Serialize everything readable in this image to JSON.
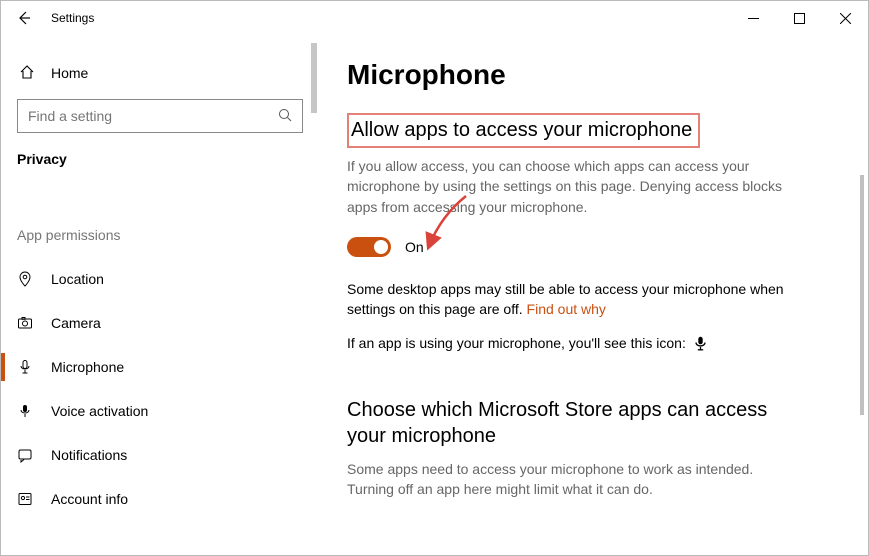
{
  "titlebar": {
    "app_title": "Settings"
  },
  "sidebar": {
    "home_label": "Home",
    "search_placeholder": "Find a setting",
    "current_page": "Privacy",
    "section_label": "App permissions",
    "items": [
      {
        "label": "Location"
      },
      {
        "label": "Camera"
      },
      {
        "label": "Microphone"
      },
      {
        "label": "Voice activation"
      },
      {
        "label": "Notifications"
      },
      {
        "label": "Account info"
      }
    ]
  },
  "main": {
    "title": "Microphone",
    "section1": {
      "heading": "Allow apps to access your microphone",
      "description": "If you allow access, you can choose which apps can access your microphone by using the settings on this page. Denying access blocks apps from accessing your microphone.",
      "toggle_state": "On",
      "desktop_note_prefix": "Some desktop apps may still be able to access your microphone when settings on this page are off. ",
      "desktop_note_link": "Find out why",
      "icon_note": "If an app is using your microphone, you'll see this icon:"
    },
    "section2": {
      "heading": "Choose which Microsoft Store apps can access your microphone",
      "description": "Some apps need to access your microphone to work as intended. Turning off an app here might limit what it can do."
    }
  },
  "colors": {
    "accent": "#CA5010",
    "highlight_border": "#E38179"
  }
}
